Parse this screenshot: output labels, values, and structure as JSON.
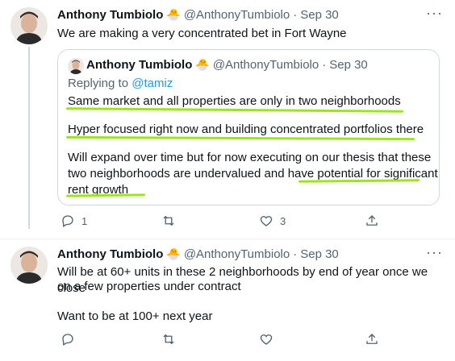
{
  "tweet1": {
    "name": "Anthony Tumbiolo",
    "handle": "@AnthonyTumbiolo",
    "date": "Sep 30",
    "text": "We are making a very concentrated bet in Fort Wayne",
    "quote": {
      "name": "Anthony Tumbiolo",
      "handle": "@AnthonyTumbiolo",
      "date": "Sep 30",
      "reply_prefix": "Replying to ",
      "reply_to": "@tamiz",
      "para1": "Same market and all properties are only in two neighborhoods",
      "para2": "Hyper focused right now and building concentrated portfolios there",
      "para3_line1": "Will expand over time but for now executing on our thesis that these",
      "para3_line2": "two neighborhoods are undervalued and have potential for significant",
      "para3_line3": "rent growth"
    },
    "actions": {
      "replies": "1",
      "retweets": "",
      "likes": "3"
    }
  },
  "tweet2": {
    "name": "Anthony Tumbiolo",
    "handle": "@AnthonyTumbiolo",
    "date": "Sep 30",
    "line1": "Will be at 60+ units in these 2 neighborhoods by end of year once we close",
    "line2": "on a few properties under contract",
    "line3": "Want to be at 100+ next year",
    "actions": {
      "replies": "",
      "retweets": "",
      "likes": ""
    }
  },
  "colors": {
    "highlight": "#9be61a",
    "accent": "#1d9bf0",
    "muted": "#536471"
  },
  "icons": [
    "reply-icon",
    "retweet-icon",
    "like-icon",
    "share-icon",
    "more-icon",
    "chick-emoji"
  ]
}
